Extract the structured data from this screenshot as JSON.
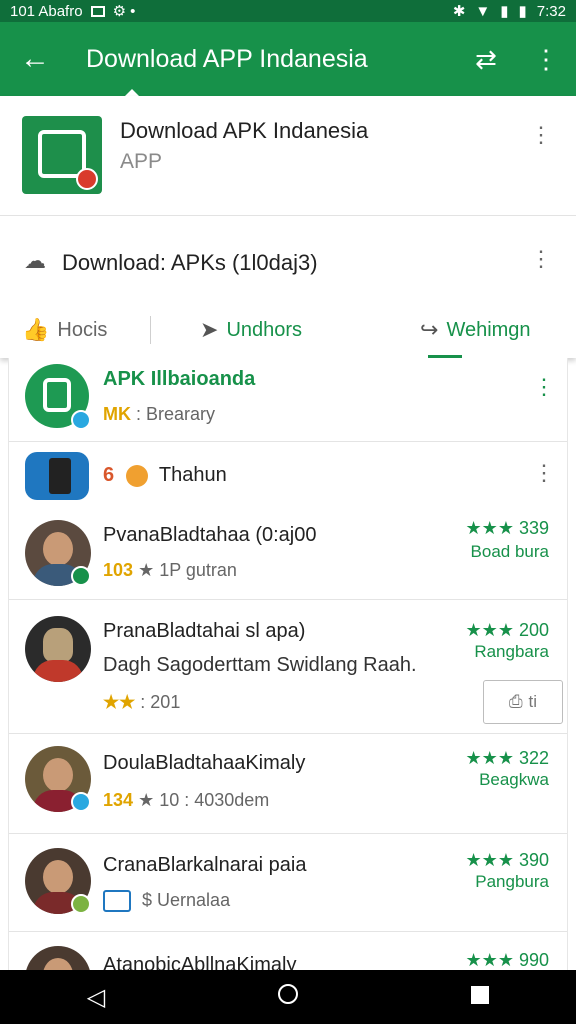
{
  "status_bar": {
    "left_text": "101 Abafro",
    "extra": "⚙ •",
    "time": "7:32"
  },
  "app_bar": {
    "title": "Download APP Indanesia",
    "back_icon": "arrow-left-icon",
    "share_icon": "sync-icon",
    "menu_icon": "more-vert-icon"
  },
  "app_header": {
    "name": "Download APK Indanesia",
    "type": "APP"
  },
  "download_row": {
    "text": "Download: APKs (1l0daj3)"
  },
  "tabs": [
    {
      "label": "Hocis",
      "icon": "thumb-icon"
    },
    {
      "label": "Undhors",
      "icon": "send-icon"
    },
    {
      "label": "Wehimgn",
      "icon": "share-arrow-icon"
    }
  ],
  "list": [
    {
      "title": "APK Illbaioanda",
      "sub_prefix": "MK",
      "sub_text": ": Brearary"
    },
    {
      "number": "6",
      "title": "Thahun"
    },
    {
      "title": "PvanaBladtahaa (0:aj00",
      "gold": "103",
      "sub_text": "★ 1P gutran",
      "rating": "★★★ 339",
      "rating_sub": "Boad bura"
    },
    {
      "title": "PranaBladtahai sl apa)",
      "line2": "Dagh Sagoderttam Swidlang Raah.",
      "stars": "★★",
      "sub_text": ": 201",
      "rating": "★★★ 200",
      "rating_sub": "Rangbara",
      "action": "ti"
    },
    {
      "title": "DoulaBladtahaaKimaly",
      "gold": "134",
      "sub_text": "★ 10 : 4030dem",
      "rating": "★★★ 322",
      "rating_sub": "Beagkwa"
    },
    {
      "title": "CranaBlarkalnarai paia",
      "sub_text": "$ Uernalaa",
      "rating": "★★★ 390",
      "rating_sub": "Pangbura"
    },
    {
      "title": "AtanobicAbllnaKimaly",
      "rating": "★★★ 990"
    }
  ],
  "colors": {
    "primary": "#17914a",
    "status": "#0f6e3a",
    "gold": "#e0a400"
  }
}
